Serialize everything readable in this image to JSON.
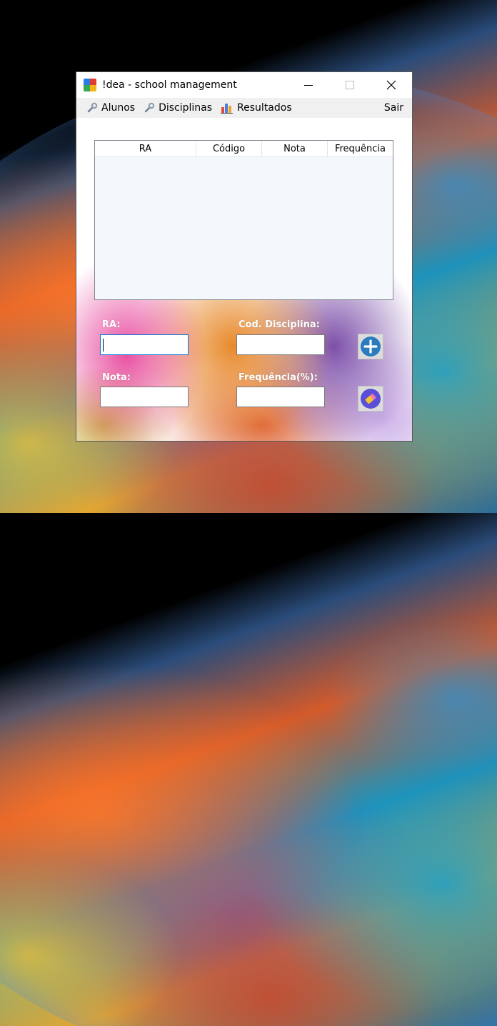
{
  "window": {
    "title": "!dea - school management"
  },
  "menu": {
    "items": [
      {
        "label": "Alunos",
        "icon": "wrench-icon"
      },
      {
        "label": "Disciplinas",
        "icon": "wrench-icon"
      },
      {
        "label": "Resultados",
        "icon": "bar-chart-icon"
      }
    ],
    "exit_label": "Sair"
  },
  "table": {
    "columns": [
      "RA",
      "Código",
      "Nota",
      "Frequência"
    ],
    "rows": []
  },
  "form": {
    "ra_label": "RA:",
    "ra_value": "",
    "cod_label": "Cod. Disciplina:",
    "cod_value": "",
    "nota_label": "Nota:",
    "nota_value": "",
    "freq_label": "Frequência(%):",
    "freq_value": "",
    "add_icon": "plus-circle-icon",
    "edit_icon": "eraser-icon"
  },
  "colors": {
    "accent": "#2b7bbf",
    "focus_border": "#0078d7",
    "menubar": "#f0f0f0"
  }
}
